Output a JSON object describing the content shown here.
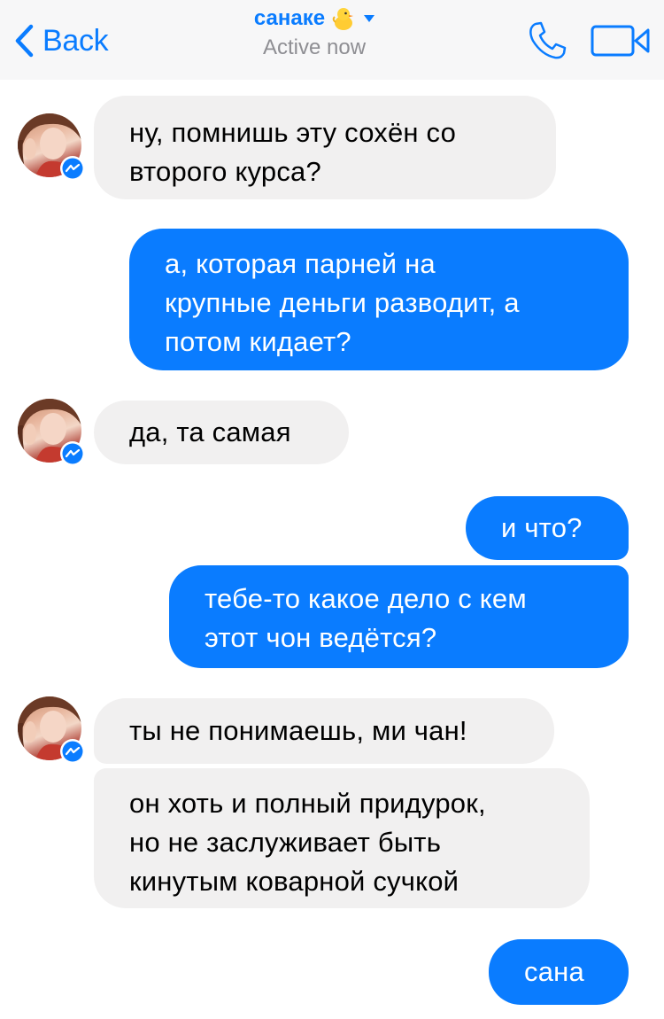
{
  "header": {
    "back_label": "Back",
    "contact_name": "санаке",
    "status": "Active now",
    "accent_color": "#0a7cff"
  },
  "icons": {
    "back": "chevron-left-icon",
    "name_emoji": "baby-chick-icon",
    "dropdown": "caret-down-icon",
    "call": "phone-icon",
    "video": "video-camera-icon"
  },
  "messages": [
    {
      "sender": "contact",
      "text": "ну, помнишь эту сохён со\nвторого курса?"
    },
    {
      "sender": "me",
      "text": "а, которая парней на\nкрупные деньги разводит, а\nпотом кидает?"
    },
    {
      "sender": "contact",
      "text": "да, та самая"
    },
    {
      "sender": "me",
      "text": "и что?"
    },
    {
      "sender": "me",
      "text": "тебе-то какое дело с кем\nэтот чон ведётся?"
    },
    {
      "sender": "contact",
      "text": "ты не понимаешь, ми чан!"
    },
    {
      "sender": "contact",
      "text": "он хоть и полный придурок,\nно не заслуживает быть\nкинутым коварной сучкой"
    },
    {
      "sender": "me",
      "text": "сана"
    }
  ],
  "colors": {
    "incoming_bubble": "#f1f0f0",
    "outgoing_bubble": "#0a7cff",
    "header_bg": "#f7f7f8"
  }
}
